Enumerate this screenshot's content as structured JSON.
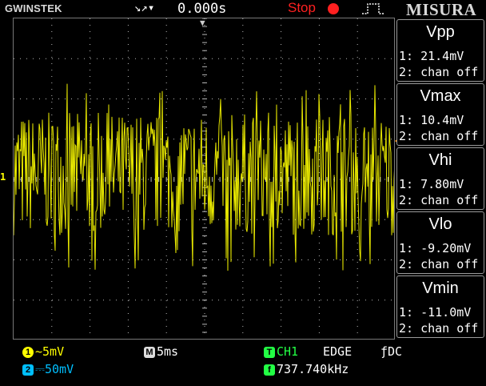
{
  "header": {
    "brand": "GWINSTEK",
    "trigger_icon": "trigger-arrows-icon",
    "time_position": "0.000s",
    "run_status": "Stop",
    "menu_title": "MISURA"
  },
  "measurements": [
    {
      "title": "Vpp",
      "ch1": "1: 21.4mV",
      "ch2": "2: chan off"
    },
    {
      "title": "Vmax",
      "ch1": "1: 10.4mV",
      "ch2": "2: chan off"
    },
    {
      "title": "Vhi",
      "ch1": "1: 7.80mV",
      "ch2": "2: chan off"
    },
    {
      "title": "Vlo",
      "ch1": "1: -9.20mV",
      "ch2": "2: chan off"
    },
    {
      "title": "Vmin",
      "ch1": "1: -11.0mV",
      "ch2": "2: chan off"
    }
  ],
  "status": {
    "ch1_scale": "5mV",
    "ch2_scale": "50mV",
    "timebase": "5ms",
    "trigger_source": "CH1",
    "trigger_type": "EDGE",
    "trigger_coupling": "DC",
    "frequency": "737.740kHz",
    "ch1_badge": "1",
    "ch2_badge": "2",
    "timebase_badge": "M",
    "trigger_badge": "T",
    "freq_badge": "f"
  },
  "markers": {
    "ch1_ground_label": "1"
  },
  "colors": {
    "ch1": "#ffff00",
    "ch2": "#00bfff",
    "trace": "#e8e800",
    "stop": "#ff2020",
    "trigger_text": "#22ff44",
    "grid": "#b8b8b8"
  },
  "waveform": {
    "volts_per_div": 5,
    "unit": "mV",
    "mean_mv": 0.0,
    "vmax_mv": 10.4,
    "vmin_mv": -11.0,
    "vhi_mv": 7.8,
    "vlo_mv": -9.2
  }
}
